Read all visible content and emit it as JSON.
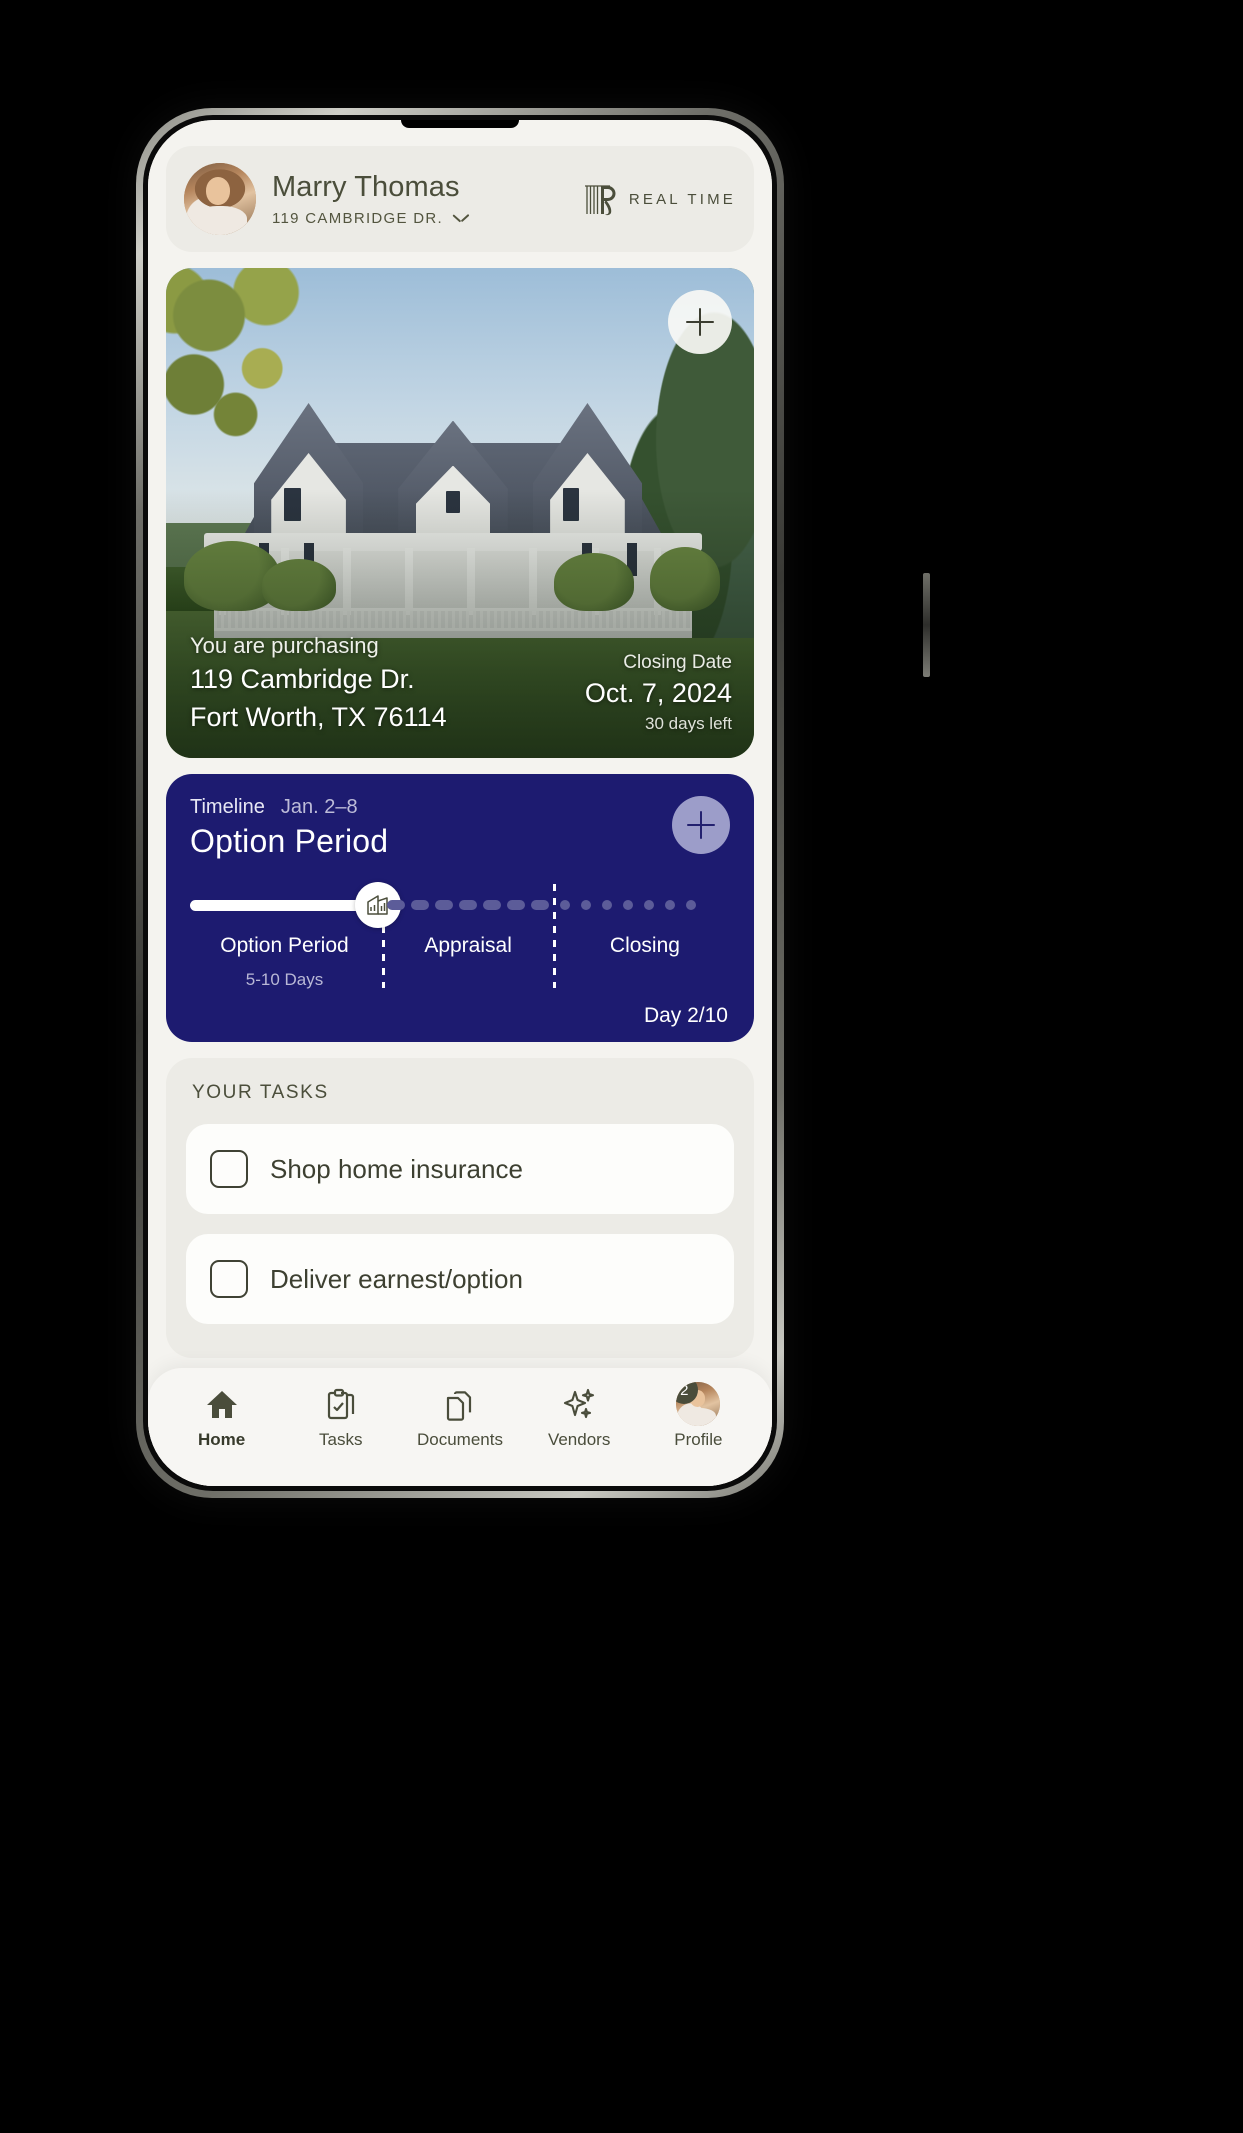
{
  "header": {
    "user_name": "Marry Thomas",
    "address_short": "119 CAMBRIDGE DR.",
    "chevron_icon": "chevron-down-icon",
    "brand_text": "REAL TIME",
    "brand_mark_icon": "r-monogram-icon",
    "avatar_icon": "user-avatar"
  },
  "property": {
    "add_icon": "plus-icon",
    "purchasing_label": "You are purchasing",
    "address_line1": "119 Cambridge Dr.",
    "address_line2": "Fort Worth, TX 76114",
    "closing_label": "Closing Date",
    "closing_date": "Oct. 7, 2024",
    "days_left": "30 days left"
  },
  "timeline": {
    "kicker": "Timeline",
    "date_range": "Jan. 2–8",
    "title": "Option Period",
    "add_icon": "plus-icon",
    "marker_icon": "house-chart-icon",
    "day_counter": "Day 2/10",
    "accent_color": "#1d1b70",
    "steps": [
      {
        "label": "Option Period",
        "sub": "5-10 Days",
        "state": "active",
        "style": "bar",
        "progress_pct": 100
      },
      {
        "label": "Appraisal",
        "sub": "",
        "state": "upcoming",
        "style": "dashes",
        "count": 7
      },
      {
        "label": "Closing",
        "sub": "",
        "state": "upcoming",
        "style": "dots",
        "count": 7
      }
    ]
  },
  "tasks": {
    "section_title": "YOUR TASKS",
    "items": [
      {
        "label": "Shop home insurance",
        "checked": false
      },
      {
        "label": "Deliver earnest/option",
        "checked": false
      }
    ]
  },
  "nav": {
    "items": [
      {
        "label": "Home",
        "icon": "home-icon",
        "active": true
      },
      {
        "label": "Tasks",
        "icon": "clipboard-check-icon",
        "active": false
      },
      {
        "label": "Documents",
        "icon": "documents-icon",
        "active": false
      },
      {
        "label": "Vendors",
        "icon": "sparkles-icon",
        "active": false
      },
      {
        "label": "Profile",
        "icon": "avatar-icon",
        "active": false,
        "badge": "2"
      }
    ]
  }
}
